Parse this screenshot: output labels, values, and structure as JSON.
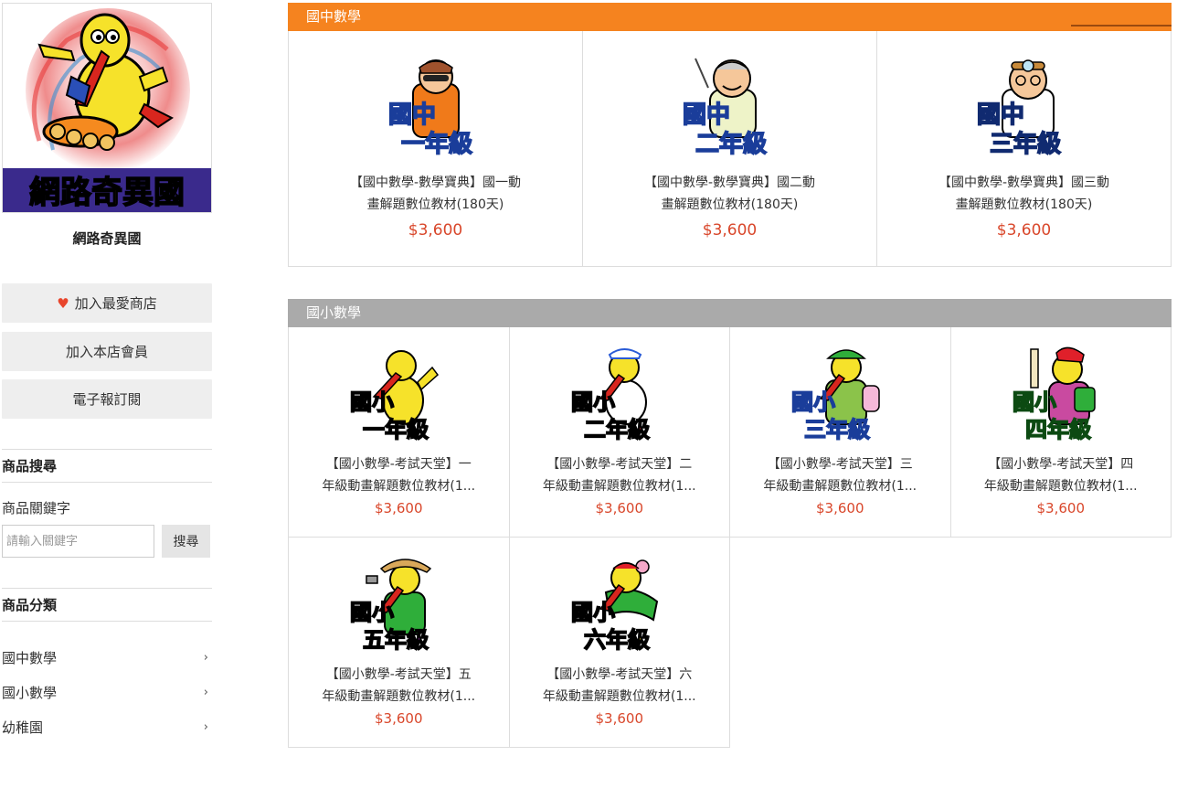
{
  "store": {
    "logo_text": "網路奇異國",
    "name": "網路奇異國"
  },
  "sidebar": {
    "favorite_label": "加入最愛商店",
    "member_label": "加入本店會員",
    "newsletter_label": "電子報訂閱",
    "search_heading": "商品搜尋",
    "keyword_label": "商品關鍵字",
    "search_placeholder": "請輸入關鍵字",
    "search_button": "搜尋",
    "category_heading": "商品分類",
    "categories": [
      "國中數學",
      "國小數學",
      "幼稚園"
    ]
  },
  "sections": [
    {
      "title": "國中數學",
      "products": [
        {
          "badge_top": "國中",
          "badge_bottom": "一年級",
          "name_line1": "【國中數學-數學寶典】國一動",
          "name_line2": "畫解題數位教材(180天)",
          "price": "$3,600"
        },
        {
          "badge_top": "國中",
          "badge_bottom": "二年級",
          "name_line1": "【國中數學-數學寶典】國二動",
          "name_line2": "畫解題數位教材(180天)",
          "price": "$3,600"
        },
        {
          "badge_top": "國中",
          "badge_bottom": "三年級",
          "name_line1": "【國中數學-數學寶典】國三動",
          "name_line2": "畫解題數位教材(180天)",
          "price": "$3,600"
        }
      ]
    },
    {
      "title": "國小數學",
      "products": [
        {
          "badge_top": "國小",
          "badge_bottom": "一年級",
          "name_line1": "【國小數學-考試天堂】一",
          "name_line2": "年級動畫解題數位教材(1...",
          "price": "$3,600"
        },
        {
          "badge_top": "國小",
          "badge_bottom": "二年級",
          "name_line1": "【國小數學-考試天堂】二",
          "name_line2": "年級動畫解題數位教材(1...",
          "price": "$3,600"
        },
        {
          "badge_top": "國小",
          "badge_bottom": "三年級",
          "name_line1": "【國小數學-考試天堂】三",
          "name_line2": "年級動畫解題數位教材(1...",
          "price": "$3,600"
        },
        {
          "badge_top": "國小",
          "badge_bottom": "四年級",
          "name_line1": "【國小數學-考試天堂】四",
          "name_line2": "年級動畫解題數位教材(1...",
          "price": "$3,600"
        },
        {
          "badge_top": "國小",
          "badge_bottom": "五年級",
          "name_line1": "【國小數學-考試天堂】五",
          "name_line2": "年級動畫解題數位教材(1...",
          "price": "$3,600"
        },
        {
          "badge_top": "國小",
          "badge_bottom": "六年級",
          "name_line1": "【國小數學-考試天堂】六",
          "name_line2": "年級動畫解題數位教材(1...",
          "price": "$3,600"
        }
      ]
    }
  ],
  "colors": {
    "section_orange": "#f5831f",
    "section_gray": "#aaaaaa",
    "price": "#d9472b",
    "heart": "#e8452c",
    "badge_cyan": "#22c4e8",
    "badge_blue": "#2a5bd6",
    "badge_red": "#e0202a",
    "badge_green": "#2fae3a",
    "badge_purple": "#c040d8",
    "badge_yellow": "#f3c818"
  }
}
